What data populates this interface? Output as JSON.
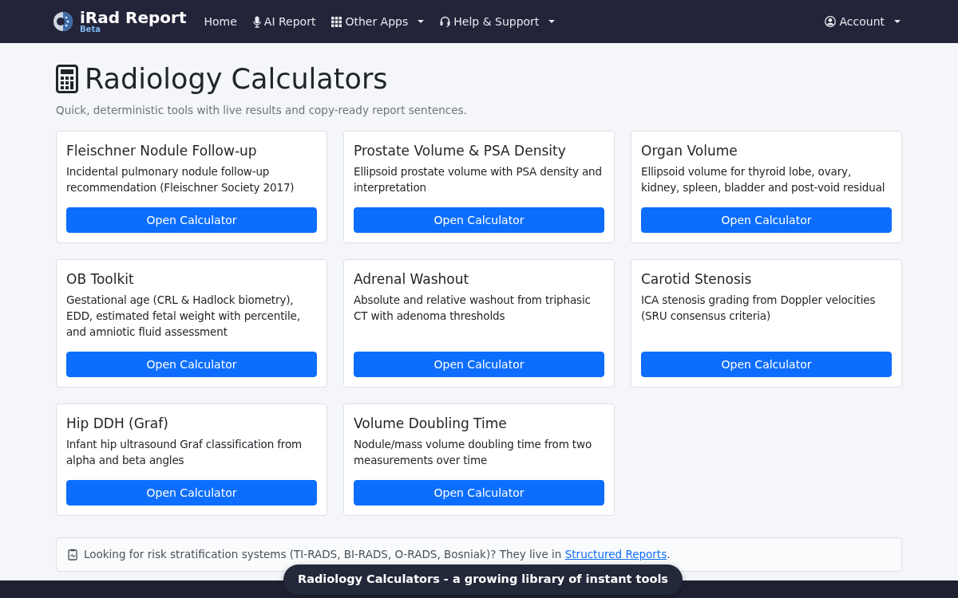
{
  "navbar": {
    "brand": "iRad Report",
    "brand_badge": "Beta",
    "items": [
      {
        "label": "Home",
        "dropdown": false
      },
      {
        "label": "AI Report",
        "dropdown": false
      },
      {
        "label": "Other Apps",
        "dropdown": true
      },
      {
        "label": "Help & Support",
        "dropdown": true
      }
    ],
    "account": {
      "label": "Account",
      "dropdown": true
    }
  },
  "page": {
    "title": "Radiology Calculators",
    "subtitle": "Quick, deterministic tools with live results and copy-ready report sentences."
  },
  "calculators": [
    {
      "title": "Fleischner Nodule Follow-up",
      "description": "Incidental pulmonary nodule follow-up recommendation (Fleischner Society 2017)",
      "button": "Open Calculator"
    },
    {
      "title": "Prostate Volume & PSA Density",
      "description": "Ellipsoid prostate volume with PSA density and interpretation",
      "button": "Open Calculator"
    },
    {
      "title": "Organ Volume",
      "description": "Ellipsoid volume for thyroid lobe, ovary, kidney, spleen, bladder and post-void residual",
      "button": "Open Calculator"
    },
    {
      "title": "OB Toolkit",
      "description": "Gestational age (CRL & Hadlock biometry), EDD, estimated fetal weight with percentile, and amniotic fluid assessment",
      "button": "Open Calculator"
    },
    {
      "title": "Adrenal Washout",
      "description": "Absolute and relative washout from triphasic CT with adenoma thresholds",
      "button": "Open Calculator"
    },
    {
      "title": "Carotid Stenosis",
      "description": "ICA stenosis grading from Doppler velocities (SRU consensus criteria)",
      "button": "Open Calculator"
    },
    {
      "title": "Hip DDH (Graf)",
      "description": "Infant hip ultrasound Graf classification from alpha and beta angles",
      "button": "Open Calculator"
    },
    {
      "title": "Volume Doubling Time",
      "description": "Nodule/mass volume doubling time from two measurements over time",
      "button": "Open Calculator"
    }
  ],
  "notice": {
    "text": "Looking for risk stratification systems (TI-RADS, BI-RADS, O-RADS, Bosniak)? They live in",
    "link": "Structured Reports",
    "after": "."
  },
  "toast": {
    "text": "Radiology Calculators - a growing library of instant tools"
  }
}
